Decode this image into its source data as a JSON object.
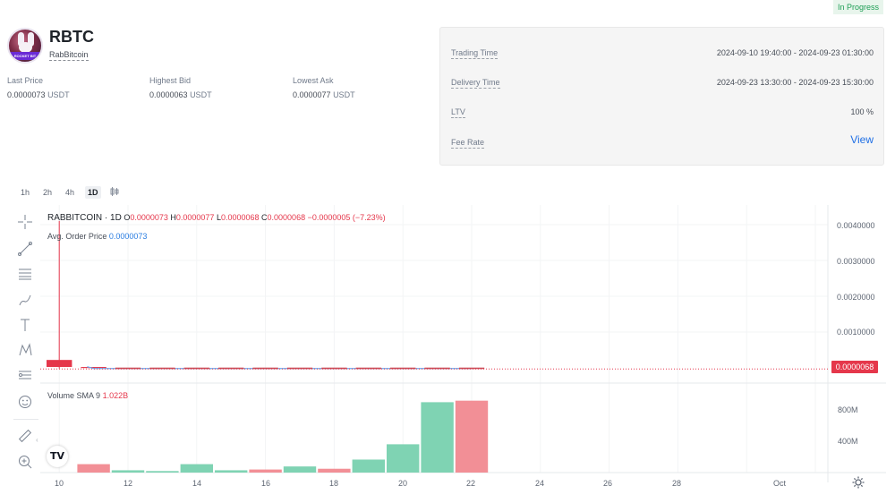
{
  "status": {
    "label": "In Progress",
    "color": "#1e9e55"
  },
  "token": {
    "symbol": "RBTC",
    "name": "RabBitcoin",
    "avatar_icon": "rabbit-avatar-icon",
    "avatar_caption": "ROCKET BIT"
  },
  "stats": [
    {
      "label": "Last Price",
      "value": "0.0000073",
      "unit": "USDT"
    },
    {
      "label": "Highest Bid",
      "value": "0.0000063",
      "unit": "USDT"
    },
    {
      "label": "Lowest Ask",
      "value": "0.0000077",
      "unit": "USDT"
    }
  ],
  "info": {
    "trading_time": {
      "label": "Trading Time",
      "value": "2024-09-10 19:40:00 - 2024-09-23 01:30:00"
    },
    "delivery_time": {
      "label": "Delivery Time",
      "value": "2024-09-23 13:30:00 - 2024-09-23 15:30:00"
    },
    "ltv": {
      "label": "LTV",
      "value": "100 %"
    },
    "fee_rate": {
      "label": "Fee Rate",
      "value": "View"
    }
  },
  "timeframes": [
    "1h",
    "2h",
    "4h",
    "1D"
  ],
  "active_timeframe": "1D",
  "chart_type_icon": "candlestick-icon",
  "tools": [
    "crosshair-icon",
    "trend-line-icon",
    "horizontal-lines-icon",
    "brush-icon",
    "text-icon",
    "pattern-icon",
    "measure-icon",
    "emoji-icon",
    "ruler-icon",
    "zoom-in-icon"
  ],
  "legend": {
    "symbol": "RABBITCOIN · 1D",
    "open_label": "O",
    "open": "0.0000073",
    "high_label": "H",
    "high": "0.0000077",
    "low_label": "L",
    "low": "0.0000068",
    "close_label": "C",
    "close": "0.0000068",
    "change": "−0.0000005 (−7.23%)",
    "avg_label": "Avg. Order Price",
    "avg_value": "0.0000073",
    "volume_label": "Volume SMA 9",
    "volume_value": "1.022B"
  },
  "colors": {
    "up": "#7fd3b3",
    "down": "#f28f96",
    "down_candle": "#e5374b",
    "avg_line": "#2a7de1"
  },
  "price_axis_ticks": [
    "0.0040000",
    "0.0030000",
    "0.0020000",
    "0.0010000"
  ],
  "last_price_tag": "0.0000068",
  "volume_axis_ticks": [
    "800M",
    "400M"
  ],
  "x_axis_ticks": [
    "10",
    "12",
    "14",
    "16",
    "18",
    "20",
    "22",
    "24",
    "26",
    "28",
    "Oct"
  ],
  "chart_data": {
    "type": "bar",
    "categories": [
      "10",
      "11",
      "12",
      "13",
      "14",
      "15",
      "16",
      "17",
      "18",
      "19",
      "20",
      "21",
      "22"
    ],
    "series": [
      {
        "name": "Volume",
        "values": [
          0,
          110,
          30,
          20,
          110,
          30,
          40,
          80,
          50,
          170,
          370,
          920,
          940
        ]
      }
    ],
    "directions": [
      "down",
      "down",
      "up",
      "up",
      "up",
      "up",
      "down",
      "up",
      "down",
      "up",
      "up",
      "up",
      "down"
    ],
    "price_candles": [
      {
        "x": "10",
        "open": 0.00025,
        "high": 0.0042,
        "low": 6.8e-06,
        "close": 5e-05
      },
      {
        "x": "11",
        "open": 5e-05,
        "high": 5e-05,
        "low": 2e-05,
        "close": 2e-05
      }
    ],
    "ylim_price": [
      0,
      0.0044
    ],
    "ylim_volume": [
      0,
      1100
    ]
  }
}
